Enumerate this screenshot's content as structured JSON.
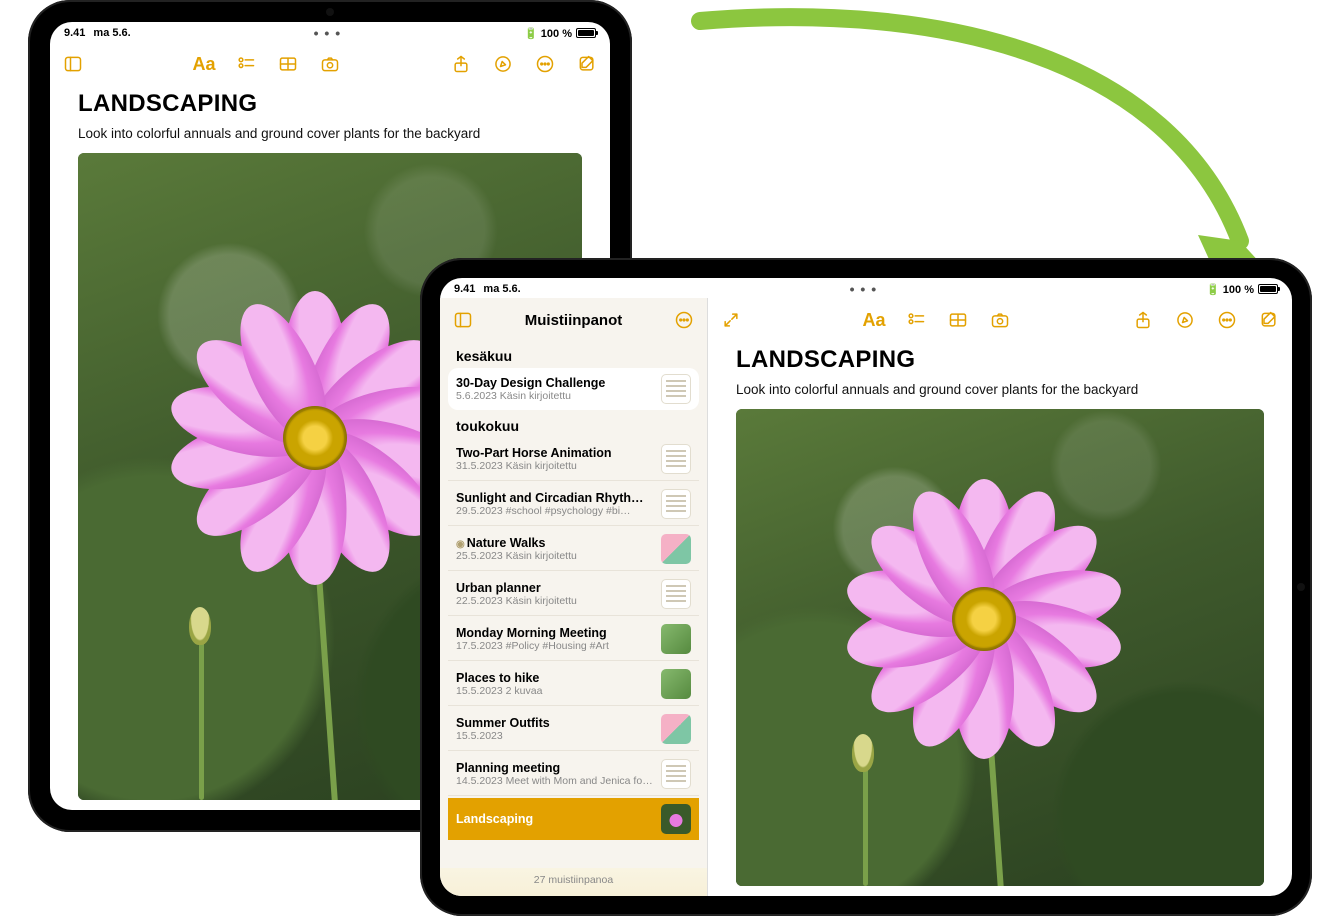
{
  "status": {
    "time": "9.41",
    "date": "ma 5.6.",
    "battery": "100 %"
  },
  "multitask_dots": "• • •",
  "note": {
    "title": "Landscaping",
    "body": "Look into colorful annuals and ground cover plants for the backyard"
  },
  "sidebar": {
    "title": "Muistiinpanot",
    "footer": "27 muistiinpanoa",
    "sections": [
      {
        "label": "kesäkuu",
        "items": [
          {
            "title": "30-Day Design Challenge",
            "date": "5.6.2023",
            "sub": "Käsin kirjoitettu"
          }
        ]
      },
      {
        "label": "toukokuu",
        "items": [
          {
            "title": "Two-Part Horse Animation",
            "date": "31.5.2023",
            "sub": "Käsin kirjoitettu"
          },
          {
            "title": "Sunlight and Circadian Rhyth…",
            "date": "29.5.2023",
            "sub": "#school #psychology #bi…"
          },
          {
            "title": "Nature Walks",
            "date": "25.5.2023",
            "sub": "Käsin kirjoitettu",
            "pinned": true
          },
          {
            "title": "Urban planner",
            "date": "22.5.2023",
            "sub": "Käsin kirjoitettu"
          },
          {
            "title": "Monday Morning Meeting",
            "date": "17.5.2023",
            "sub": "#Policy #Housing #Art"
          },
          {
            "title": "Places to hike",
            "date": "15.5.2023",
            "sub": "2 kuvaa"
          },
          {
            "title": "Summer Outfits",
            "date": "15.5.2023",
            "sub": ""
          },
          {
            "title": "Planning meeting",
            "date": "14.5.2023",
            "sub": "Meet with Mom and Jenica for m…"
          },
          {
            "title": "Landscaping",
            "date": "",
            "sub": "",
            "selected": true
          }
        ]
      }
    ]
  },
  "colors": {
    "accent": "#e3a100",
    "arrow": "#8cc63f"
  }
}
